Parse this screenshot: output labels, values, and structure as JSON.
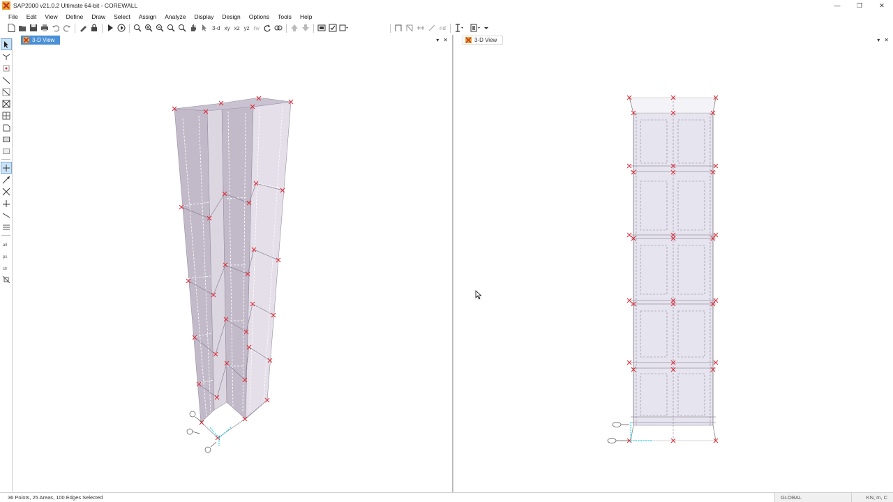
{
  "window": {
    "title": "SAP2000 v21.0.2 Ultimate 64-bit - COREWALL",
    "minimize": "—",
    "restore": "❐",
    "close": "✕"
  },
  "menu": [
    "File",
    "Edit",
    "View",
    "Define",
    "Draw",
    "Select",
    "Assign",
    "Analyze",
    "Display",
    "Design",
    "Options",
    "Tools",
    "Help"
  ],
  "toolbar": {
    "view_3d": "3-d",
    "view_xy": "xy",
    "view_xz": "xz",
    "view_yz": "yz",
    "view_nv": "nv",
    "nd": "nd"
  },
  "panels": {
    "left": {
      "tab_label": "3-D View",
      "dropdown": "▾",
      "close": "✕"
    },
    "right": {
      "tab_label": "3-D View",
      "dropdown": "▾",
      "close": "✕"
    }
  },
  "status": {
    "selection": "36 Points, 25 Areas, 100 Edges Selected",
    "coord_system": "GLOBAL",
    "units": "KN, m, C"
  },
  "colors": {
    "wall_fill": "#b7aec0",
    "joint": "#e0303a",
    "axis": "#24d7e6",
    "active_tab": "#4a90d9"
  }
}
